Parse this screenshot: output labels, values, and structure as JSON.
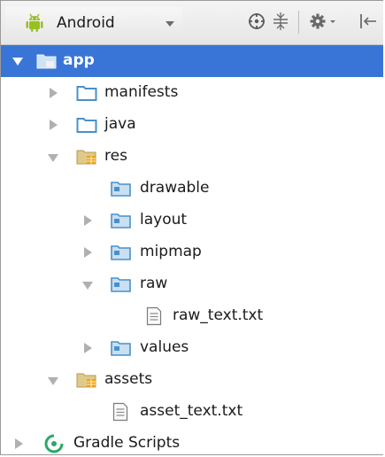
{
  "toolbar": {
    "view_mode": "Android",
    "icons": [
      "sync-locate-icon",
      "collapse-all-icon",
      "settings-icon",
      "hide-panel-icon"
    ]
  },
  "tree": [
    {
      "label": "app",
      "icon": "module-folder-icon",
      "expanded": true,
      "selected": true
    },
    {
      "label": "manifests",
      "icon": "folder-icon",
      "expanded": false
    },
    {
      "label": "java",
      "icon": "folder-icon",
      "expanded": false
    },
    {
      "label": "res",
      "icon": "resource-folder-icon",
      "expanded": true
    },
    {
      "label": "drawable",
      "icon": "folder-icon"
    },
    {
      "label": "layout",
      "icon": "folder-icon",
      "expanded": false
    },
    {
      "label": "mipmap",
      "icon": "folder-icon",
      "expanded": false
    },
    {
      "label": "raw",
      "icon": "folder-icon",
      "expanded": true
    },
    {
      "label": "raw_text.txt",
      "icon": "text-file-icon"
    },
    {
      "label": "values",
      "icon": "folder-icon",
      "expanded": false
    },
    {
      "label": "assets",
      "icon": "resource-folder-icon",
      "expanded": true
    },
    {
      "label": "asset_text.txt",
      "icon": "text-file-icon"
    },
    {
      "label": "Gradle Scripts",
      "icon": "gradle-icon",
      "expanded": false
    }
  ],
  "colors": {
    "selection": "#3875d7",
    "folder": "#5a9fd4"
  }
}
